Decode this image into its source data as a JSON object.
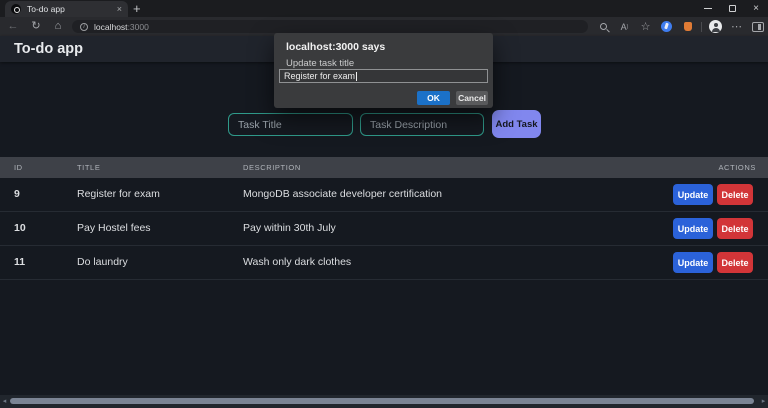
{
  "icons": {
    "close": "×",
    "plus": "+",
    "back": "←",
    "refresh": "↻",
    "home": "⌂",
    "info": "i",
    "read_aloud": "A",
    "read_aloud_mark": ")",
    "star": "☆",
    "dots_menu": "⋯",
    "scroll_left": "◂",
    "scroll_right": "▸"
  },
  "browser": {
    "tab": {
      "title": "To-do app"
    },
    "address": {
      "host": "localhost",
      "port": ":3000"
    }
  },
  "dialog": {
    "origin_title": "localhost:3000 says",
    "message": "Update task title",
    "input_value": "Register for exam",
    "ok_label": "OK",
    "cancel_label": "Cancel"
  },
  "app": {
    "title": "To-do app",
    "form": {
      "title_placeholder": "Task Title",
      "description_placeholder": "Task Description",
      "add_button_label": "Add Task"
    },
    "table": {
      "headers": {
        "id": "ID",
        "title": "TITLE",
        "description": "DESCRIPTION",
        "actions": "ACTIONS"
      },
      "update_label": "Update",
      "delete_label": "Delete",
      "rows": [
        {
          "id": "9",
          "title": "Register for exam",
          "description": "MongoDB associate developer certification"
        },
        {
          "id": "10",
          "title": "Pay Hostel fees",
          "description": "Pay within 30th July"
        },
        {
          "id": "11",
          "title": "Do laundry",
          "description": "Wash only dark clothes"
        }
      ]
    }
  },
  "colors": {
    "accent_teal_border": "#2f9a8a",
    "add_task_purple": "#8187ee",
    "update_blue": "#2b62d9",
    "delete_red": "#d23538",
    "dialog_ok_blue": "#1b71c8"
  }
}
